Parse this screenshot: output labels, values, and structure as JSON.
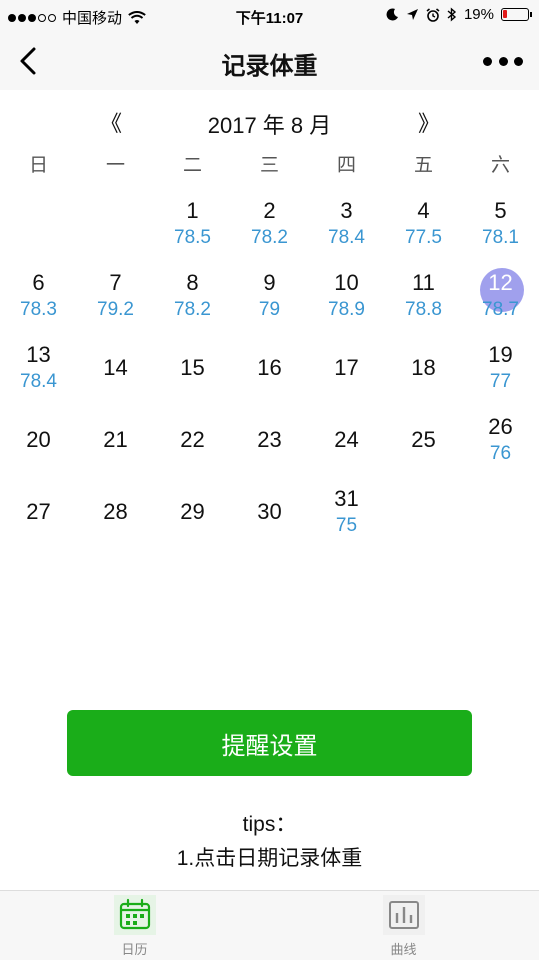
{
  "status_bar": {
    "carrier": "中国移动",
    "time": "下午11:07",
    "battery": "19%",
    "battery_level": 0.19
  },
  "nav": {
    "title": "记录体重"
  },
  "calendar": {
    "prev_symbol": "《",
    "next_symbol": "》",
    "month_title": "2017 年 8 月",
    "weekdays": [
      "日",
      "一",
      "二",
      "三",
      "四",
      "五",
      "六"
    ],
    "weeks": [
      [
        {
          "day": "",
          "weight": ""
        },
        {
          "day": "",
          "weight": ""
        },
        {
          "day": "1",
          "weight": "78.5"
        },
        {
          "day": "2",
          "weight": "78.2"
        },
        {
          "day": "3",
          "weight": "78.4"
        },
        {
          "day": "4",
          "weight": "77.5"
        },
        {
          "day": "5",
          "weight": "78.1"
        }
      ],
      [
        {
          "day": "6",
          "weight": "78.3"
        },
        {
          "day": "7",
          "weight": "79.2"
        },
        {
          "day": "8",
          "weight": "78.2"
        },
        {
          "day": "9",
          "weight": "79"
        },
        {
          "day": "10",
          "weight": "78.9"
        },
        {
          "day": "11",
          "weight": "78.8"
        },
        {
          "day": "12",
          "weight": "78.7",
          "today": true
        }
      ],
      [
        {
          "day": "13",
          "weight": "78.4"
        },
        {
          "day": "14",
          "weight": ""
        },
        {
          "day": "15",
          "weight": ""
        },
        {
          "day": "16",
          "weight": ""
        },
        {
          "day": "17",
          "weight": ""
        },
        {
          "day": "18",
          "weight": ""
        },
        {
          "day": "19",
          "weight": "77"
        }
      ],
      [
        {
          "day": "20",
          "weight": ""
        },
        {
          "day": "21",
          "weight": ""
        },
        {
          "day": "22",
          "weight": ""
        },
        {
          "day": "23",
          "weight": ""
        },
        {
          "day": "24",
          "weight": ""
        },
        {
          "day": "25",
          "weight": ""
        },
        {
          "day": "26",
          "weight": "76"
        }
      ],
      [
        {
          "day": "27",
          "weight": ""
        },
        {
          "day": "28",
          "weight": ""
        },
        {
          "day": "29",
          "weight": ""
        },
        {
          "day": "30",
          "weight": ""
        },
        {
          "day": "31",
          "weight": "75"
        },
        {
          "day": "",
          "weight": ""
        },
        {
          "day": "",
          "weight": ""
        }
      ]
    ]
  },
  "reminder_button": "提醒设置",
  "tips": {
    "label": "tips：",
    "text": "1.点击日期记录体重"
  },
  "tabs": [
    {
      "label": "日历",
      "icon": "calendar-icon"
    },
    {
      "label": "曲线",
      "icon": "chart-icon"
    }
  ],
  "colors": {
    "accent_green": "#1aad19",
    "weight_blue": "#3a96d1",
    "today_circle": "#7878e6"
  }
}
